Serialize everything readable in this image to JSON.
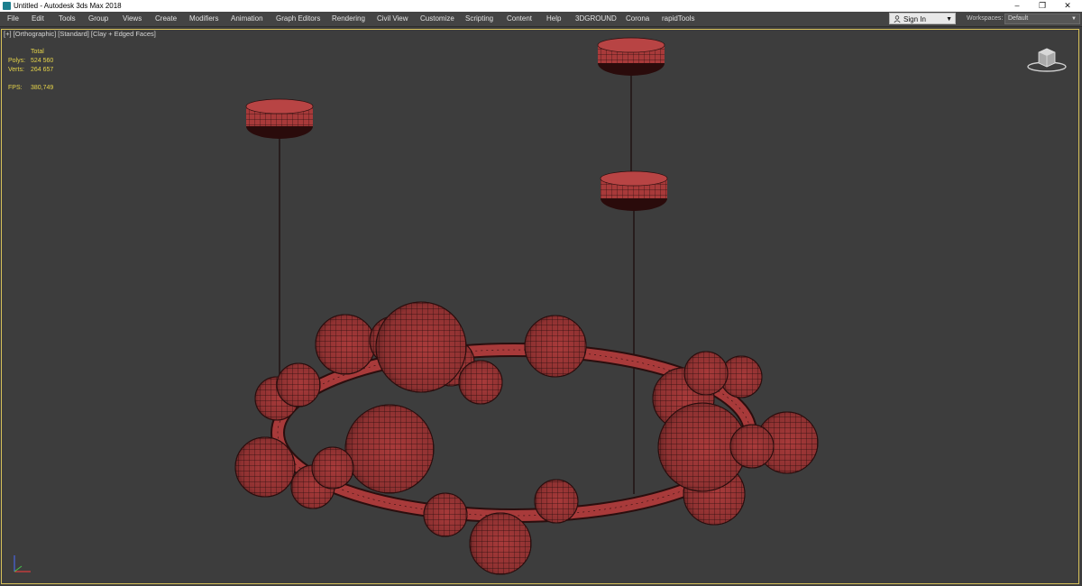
{
  "window": {
    "title": "Untitled - Autodesk 3ds Max 2018",
    "controls": {
      "minimize": "–",
      "restore": "❐",
      "close": "✕"
    }
  },
  "menu": {
    "items": [
      "File",
      "Edit",
      "Tools",
      "Group",
      "Views",
      "Create",
      "Modifiers",
      "Animation",
      "Graph Editors",
      "Rendering",
      "Civil View",
      "Customize",
      "Scripting",
      "Content",
      "Help",
      "3DGROUND",
      "Corona",
      "rapidTools"
    ]
  },
  "signin": {
    "label": "Sign In"
  },
  "workspaces": {
    "label": "Workspaces:",
    "value": "Default"
  },
  "viewport": {
    "label": "[+] [Orthographic] [Standard] [Clay + Edged Faces]",
    "stats": {
      "total_label": "Total",
      "polys_label": "Polys:",
      "polys_value": "524 560",
      "verts_label": "Verts:",
      "verts_value": "264 657",
      "fps_label": "FPS:",
      "fps_value": "380,749"
    }
  },
  "colors": {
    "accent": "#e6d44a",
    "mesh": "#a83a3a",
    "wire": "#2a0e0e",
    "background": "#3d3d3d"
  },
  "icons": {
    "app": "3ds-max-logo-icon",
    "user": "user-icon",
    "viewcube": "viewcube-icon",
    "axis": "axis-tripod-icon"
  }
}
